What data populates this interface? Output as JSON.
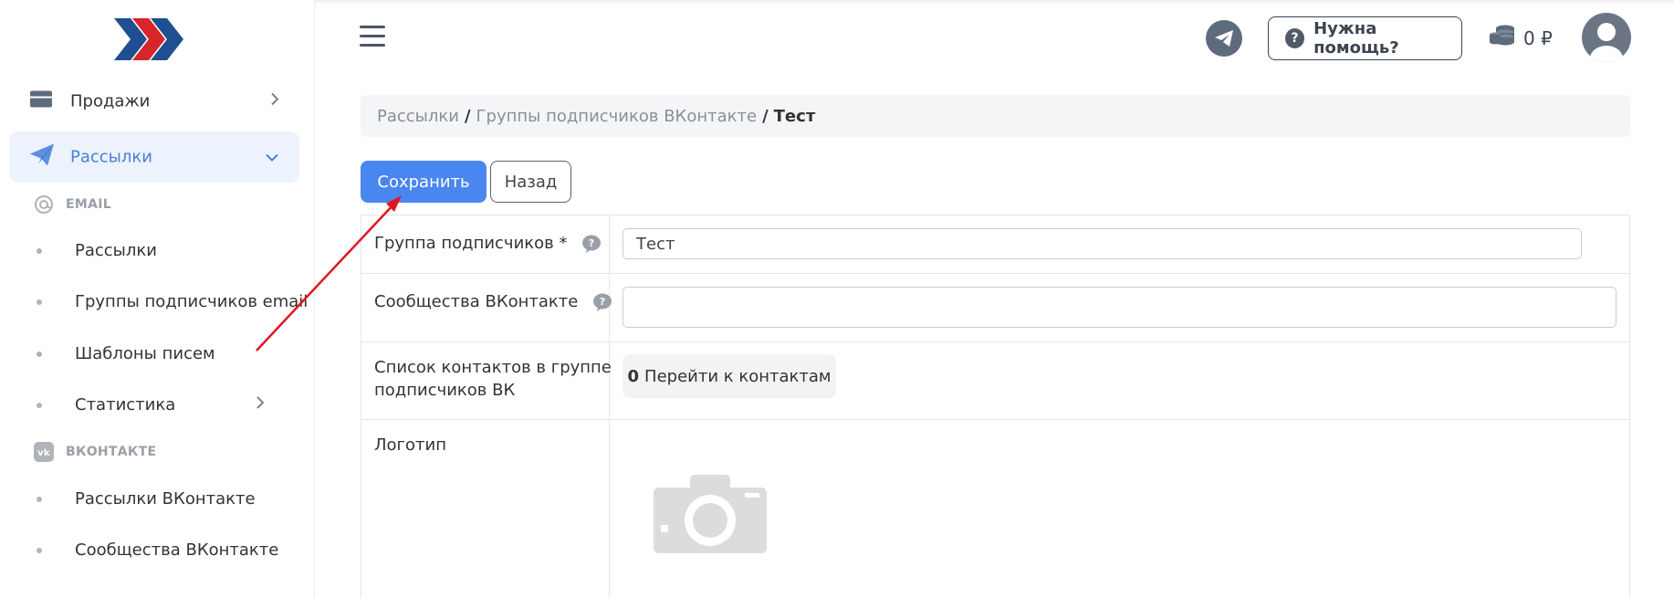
{
  "sidebar": {
    "items": [
      {
        "label": "Продажи"
      },
      {
        "label": "Рассылки"
      }
    ],
    "section_email": "EMAIL",
    "email_items": [
      {
        "label": "Рассылки"
      },
      {
        "label": "Группы подписчиков email"
      },
      {
        "label": "Шаблоны писем"
      },
      {
        "label": "Статистика"
      }
    ],
    "section_vk": "ВКОНТАКТЕ",
    "vk_items": [
      {
        "label": "Рассылки ВКонтакте"
      },
      {
        "label": "Сообщества ВКонтакте"
      }
    ]
  },
  "header": {
    "help_label": "Нужна помощь?",
    "balance": "0 ₽"
  },
  "breadcrumb": {
    "items": [
      "Рассылки",
      "Группы подписчиков ВКонтакте"
    ],
    "current": "Тест"
  },
  "toolbar": {
    "save_label": "Сохранить",
    "back_label": "Назад"
  },
  "form": {
    "group_label": "Группа подписчиков *",
    "group_value": "Тест",
    "communities_label": "Сообщества ВКонтакте",
    "communities_value": "",
    "contacts_label_line1": "Список контактов в группе",
    "contacts_label_line2": "подписчиков ВК",
    "contacts_count": "0",
    "contacts_link": "Перейти к контактам",
    "logo_label": "Логотип"
  },
  "colors": {
    "accent": "#4a86f0",
    "active_bg": "#edf3fd",
    "active_text": "#4a7ed6",
    "arrow": "#e0161e"
  }
}
